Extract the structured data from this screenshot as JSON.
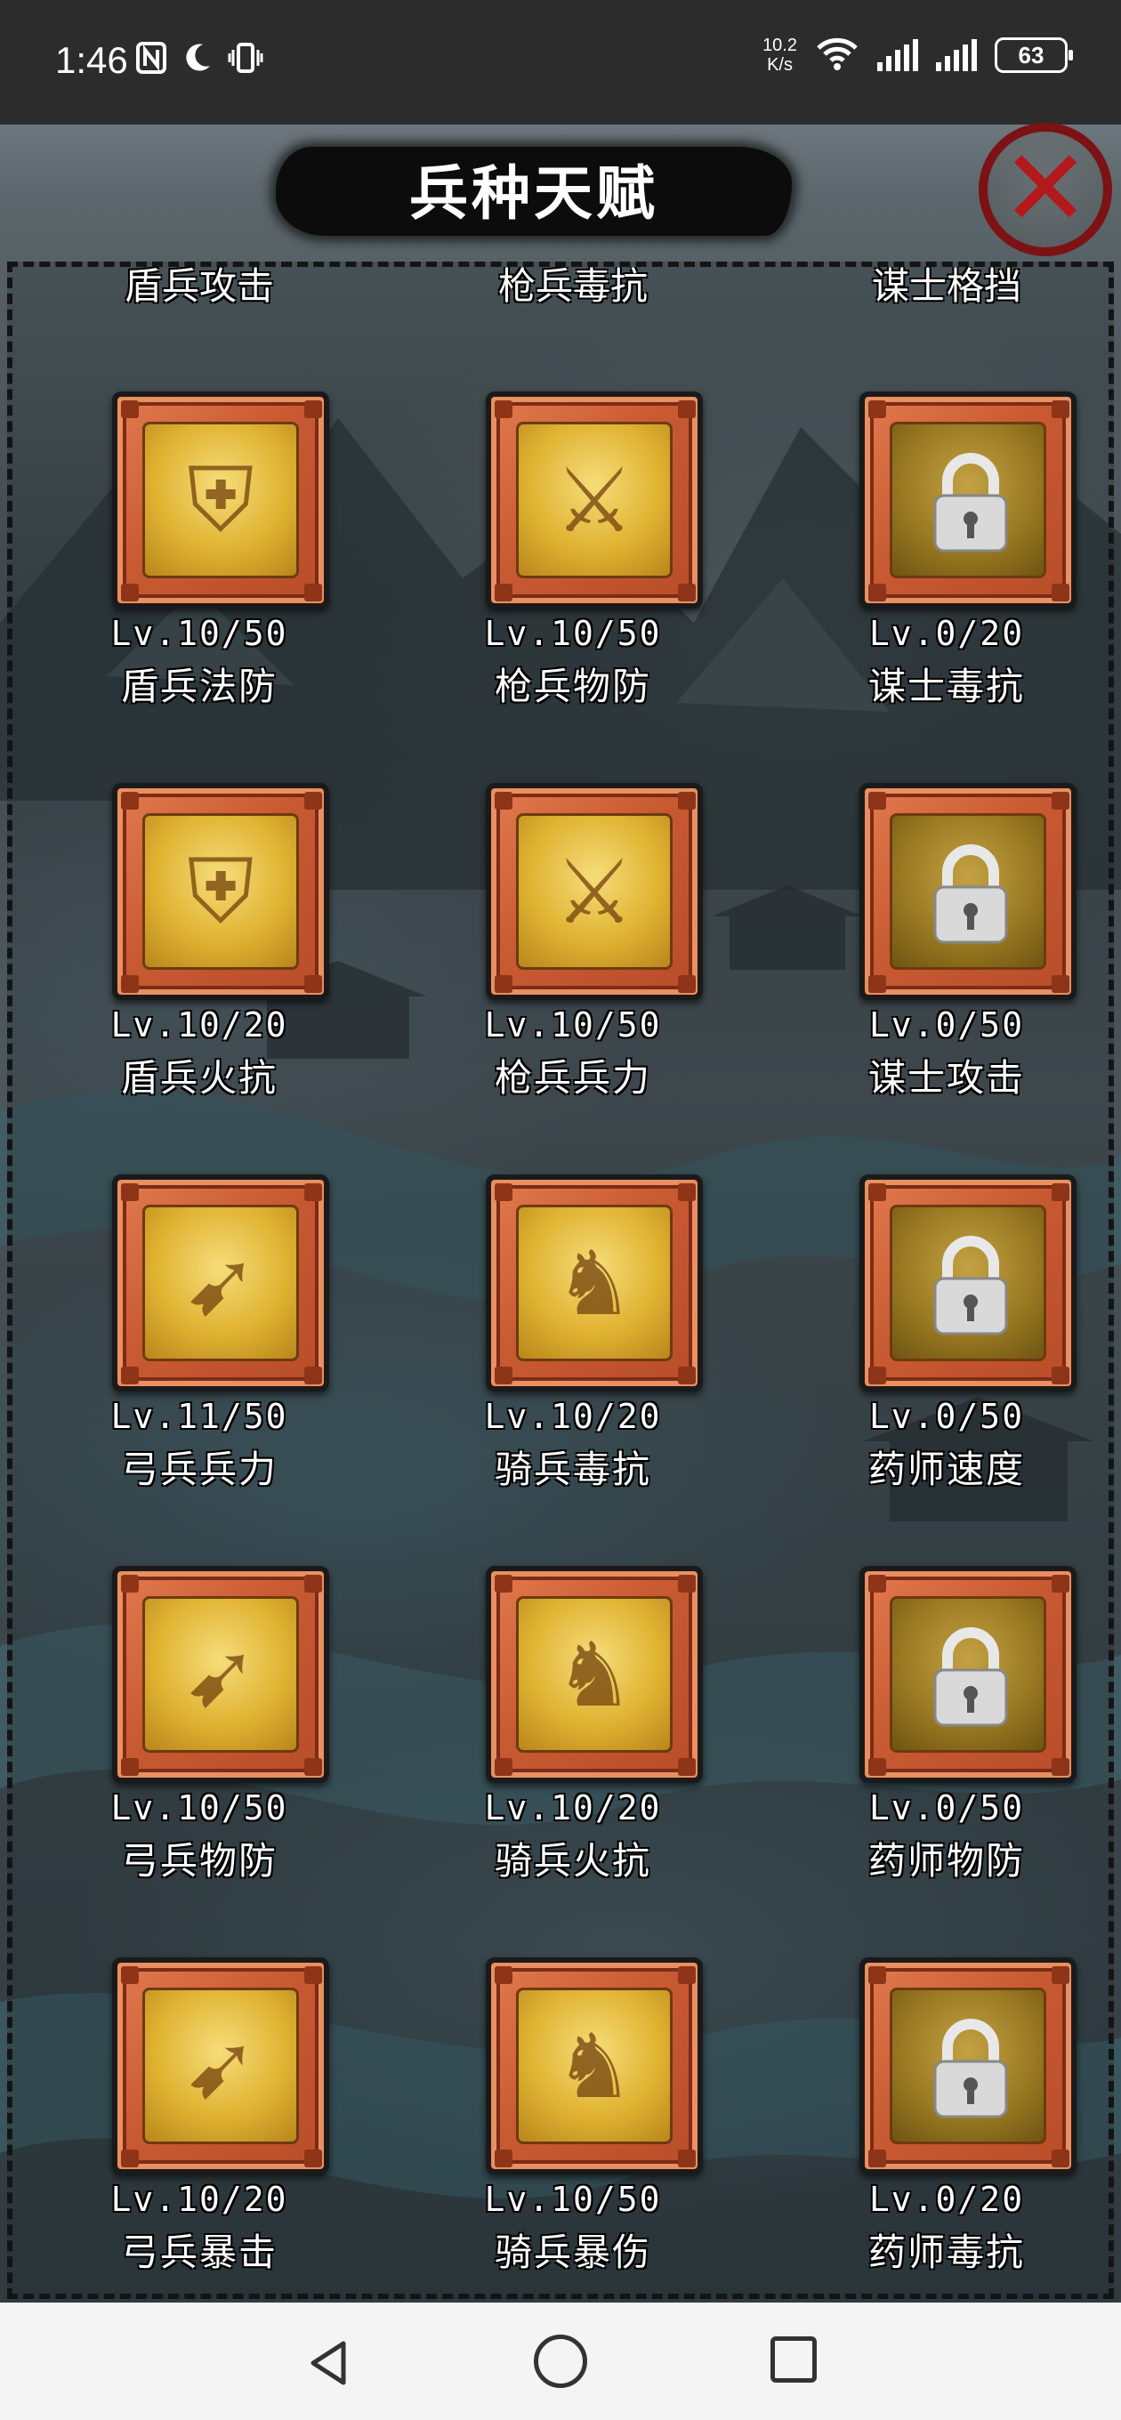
{
  "status_bar": {
    "time": "1:46",
    "left_icons": [
      "nfc-icon",
      "moon-icon",
      "vibrate-icon"
    ],
    "net_speed_value": "10.2",
    "net_speed_unit": "K/s",
    "battery": "63"
  },
  "header": {
    "title": "兵种天赋",
    "close_icon": "close-x-icon",
    "accent": "#b3191c"
  },
  "top_row_partial": [
    "盾兵攻击",
    "枪兵毒抗",
    "谋士格挡"
  ],
  "talents": [
    {
      "level": "Lv.10/50",
      "name": "盾兵法防",
      "icon": "shield-soldier-magic-icon",
      "locked": false
    },
    {
      "level": "Lv.10/50",
      "name": "枪兵物防",
      "icon": "spearman-defense-icon",
      "locked": false
    },
    {
      "level": "Lv.0/20",
      "name": "谋士毒抗",
      "icon": "lock-icon",
      "locked": true
    },
    {
      "level": "Lv.10/20",
      "name": "盾兵火抗",
      "icon": "shield-soldier-fire-icon",
      "locked": false
    },
    {
      "level": "Lv.10/50",
      "name": "枪兵兵力",
      "icon": "spearman-troops-icon",
      "locked": false
    },
    {
      "level": "Lv.0/50",
      "name": "谋士攻击",
      "icon": "lock-icon",
      "locked": true
    },
    {
      "level": "Lv.11/50",
      "name": "弓兵兵力",
      "icon": "archer-troops-icon",
      "locked": false
    },
    {
      "level": "Lv.10/20",
      "name": "骑兵毒抗",
      "icon": "cavalry-poison-icon",
      "locked": false
    },
    {
      "level": "Lv.0/50",
      "name": "药师速度",
      "icon": "lock-icon",
      "locked": true
    },
    {
      "level": "Lv.10/50",
      "name": "弓兵物防",
      "icon": "archer-defense-icon",
      "locked": false
    },
    {
      "level": "Lv.10/20",
      "name": "骑兵火抗",
      "icon": "cavalry-fire-icon",
      "locked": false
    },
    {
      "level": "Lv.0/50",
      "name": "药师物防",
      "icon": "lock-icon",
      "locked": true
    },
    {
      "level": "Lv.10/20",
      "name": "弓兵暴击",
      "icon": "archer-crit-icon",
      "locked": false
    },
    {
      "level": "Lv.10/50",
      "name": "骑兵暴伤",
      "icon": "cavalry-crit-damage-icon",
      "locked": false
    },
    {
      "level": "Lv.0/20",
      "name": "药师毒抗",
      "icon": "lock-icon",
      "locked": true
    }
  ],
  "nav": [
    "back-icon",
    "home-icon",
    "recent-apps-icon"
  ]
}
